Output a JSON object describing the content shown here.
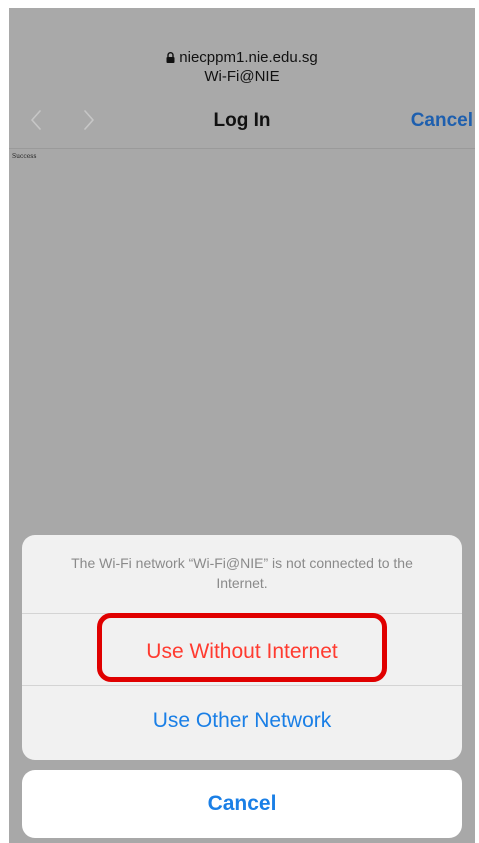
{
  "header": {
    "url": "niecppm1.nie.edu.sg",
    "network_name": "Wi-Fi@NIE",
    "title": "Log In",
    "cancel_label": "Cancel",
    "lock_icon": "lock-icon",
    "back_icon": "chevron-left-icon",
    "forward_icon": "chevron-right-icon"
  },
  "page": {
    "body_text": "Success"
  },
  "action_sheet": {
    "message": "The Wi-Fi network “Wi-Fi@NIE” is not connected to the Internet.",
    "actions": [
      {
        "label": "Use Without Internet",
        "style": "destructive",
        "highlighted": true
      },
      {
        "label": "Use Other Network",
        "style": "default"
      }
    ],
    "cancel_label": "Cancel"
  },
  "colors": {
    "overlay_gray": "#a8a8a8",
    "ios_blue": "#1a7fe6",
    "nav_blue": "#1e5fae",
    "destructive_red": "#ff3b30",
    "highlight_red": "#e00000"
  }
}
